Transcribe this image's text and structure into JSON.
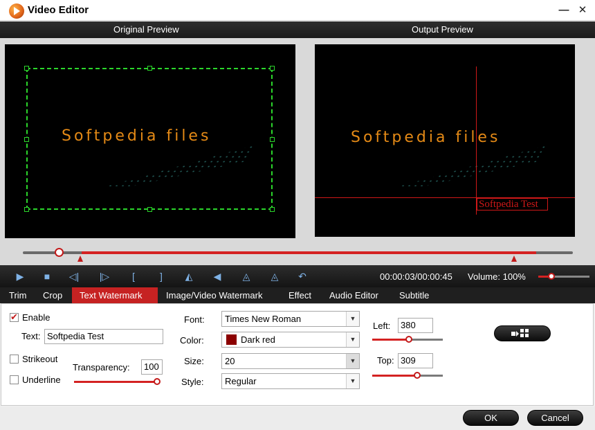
{
  "window": {
    "title": "Video Editor",
    "min_glyph": "—",
    "close_glyph": "✕"
  },
  "preview": {
    "original_label": "Original Preview",
    "output_label": "Output Preview",
    "video_text": "Softpedia files",
    "watermark_text": "Softpedia Test"
  },
  "playback": {
    "time": "00:00:03/00:00:45",
    "volume_label": "Volume:",
    "volume_value": "100%",
    "position_fraction": 0.067,
    "volume_fraction": 0.25
  },
  "controls": [
    {
      "name": "play-icon",
      "glyph": "▶"
    },
    {
      "name": "stop-icon",
      "glyph": "■"
    },
    {
      "name": "prev-frame-icon",
      "glyph": "◁|"
    },
    {
      "name": "next-frame-icon",
      "glyph": "|▷"
    },
    {
      "name": "set-start-icon",
      "glyph": "["
    },
    {
      "name": "set-end-icon",
      "glyph": "]"
    },
    {
      "name": "flip-horizontal-icon",
      "glyph": "◭"
    },
    {
      "name": "flip-vertical-icon",
      "glyph": "◀"
    },
    {
      "name": "rotate-left-icon",
      "glyph": "◬"
    },
    {
      "name": "rotate-right-icon",
      "glyph": "◬"
    },
    {
      "name": "undo-icon",
      "glyph": "↶"
    }
  ],
  "tabs": [
    {
      "label": "Trim",
      "active": false
    },
    {
      "label": "Crop",
      "active": false
    },
    {
      "label": "Text Watermark",
      "active": true
    },
    {
      "label": "Image/Video Watermark",
      "active": false
    },
    {
      "label": "Effect",
      "active": false
    },
    {
      "label": "Audio Editor",
      "active": false
    },
    {
      "label": "Subtitle",
      "active": false
    }
  ],
  "watermark": {
    "enable_label": "Enable",
    "enable_checked": true,
    "text_label": "Text:",
    "text_value": "Softpedia Test",
    "strikeout_label": "Strikeout",
    "underline_label": "Underline",
    "transparency_label": "Transparency:",
    "transparency_value": "100",
    "font_label": "Font:",
    "font_value": "Times New Roman",
    "color_label": "Color:",
    "color_value": "Dark red",
    "color_hex": "#8b0000",
    "size_label": "Size:",
    "size_value": "20",
    "style_label": "Style:",
    "style_value": "Regular",
    "left_label": "Left:",
    "left_value": "380",
    "top_label": "Top:",
    "top_value": "309"
  },
  "footer": {
    "ok_label": "OK",
    "cancel_label": "Cancel"
  },
  "colors": {
    "accent": "#c62222",
    "crop_guide": "#2bd62b",
    "video_text": "#e58a16"
  }
}
